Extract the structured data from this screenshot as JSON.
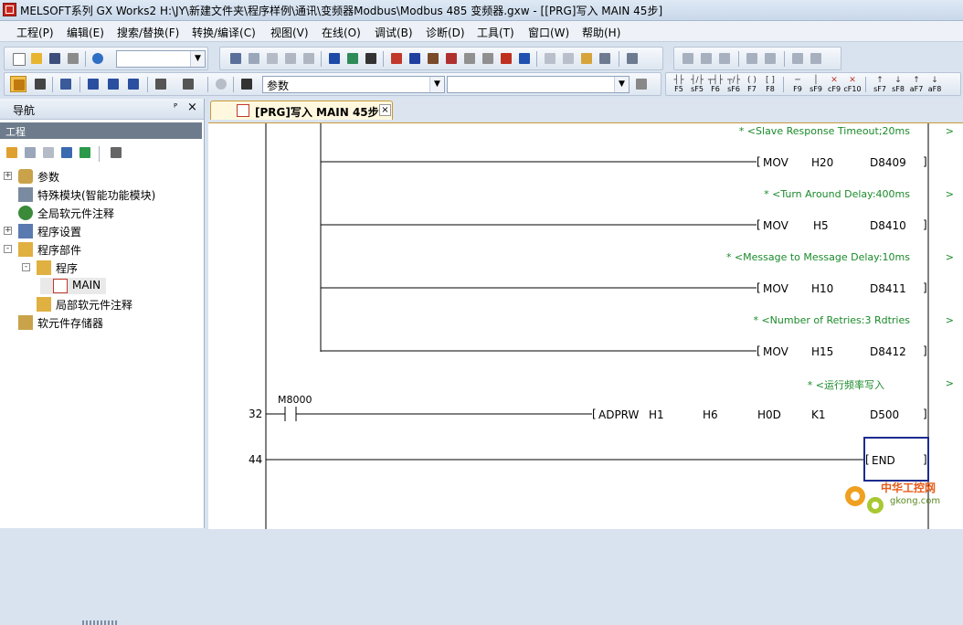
{
  "window": {
    "title": "MELSOFT系列 GX Works2 H:\\JY\\新建文件夹\\程序样例\\通讯\\变频器Modbus\\Modbus 485 变频器.gxw - [[PRG]写入 MAIN 45步]"
  },
  "menu": [
    "工程(P)",
    "编辑(E)",
    "搜索/替换(F)",
    "转换/编译(C)",
    "视图(V)",
    "在线(O)",
    "调试(B)",
    "诊断(D)",
    "工具(T)",
    "窗口(W)",
    "帮助(H)"
  ],
  "toolbar": {
    "combo1_value": "",
    "combo2_value": "参数",
    "combo3_value": "",
    "fkeys": [
      "F5",
      "sF5",
      "F6",
      "sF6",
      "F7",
      "F8",
      "F9",
      "sF9",
      "cF9",
      "cF10",
      "sF7",
      "sF8",
      "aF7",
      "aF8"
    ]
  },
  "nav": {
    "title": "导航",
    "pin": "ᴾ",
    "close": "×",
    "project_header": "工程",
    "tree": [
      {
        "label": "参数",
        "expander": "+"
      },
      {
        "label": "特殊模块(智能功能模块)",
        "expander": ""
      },
      {
        "label": "全局软元件注释",
        "expander": ""
      },
      {
        "label": "程序设置",
        "expander": "+"
      },
      {
        "label": "程序部件",
        "expander": "-"
      },
      {
        "label": "程序",
        "expander": "-"
      },
      {
        "label": "MAIN",
        "expander": ""
      },
      {
        "label": "局部软元件注释",
        "expander": ""
      },
      {
        "label": "软元件存储器",
        "expander": ""
      }
    ]
  },
  "editor": {
    "tab_label": "[PRG]写入 MAIN 45步",
    "tab_close": "×",
    "comments": [
      "* <Slave Response Timeout;20ms",
      "* <Turn Around Delay:400ms",
      "* <Message to Message Delay:10ms",
      "* <Number of Retries:3 Rdtries",
      "* <运行频率写入"
    ],
    "comment_end": ">",
    "rows": [
      {
        "op": "MOV",
        "a": "H20",
        "b": "D8409"
      },
      {
        "op": "MOV",
        "a": "H5",
        "b": "D8410"
      },
      {
        "op": "MOV",
        "a": "H10",
        "b": "D8411"
      },
      {
        "op": "MOV",
        "a": "H15",
        "b": "D8412"
      }
    ],
    "adprw": {
      "op": "ADPRW",
      "args": [
        "H1",
        "H6",
        "H0D",
        "K1",
        "D500"
      ]
    },
    "contact": "M8000",
    "step_32": "32",
    "step_44": "44",
    "end": "END"
  },
  "watermark": {
    "line1": "中华工控网",
    "line2": "gkong.com"
  },
  "colors": {
    "comment": "#1a8a2a",
    "selection": "#1d2b8f",
    "tab_border": "#c79a3c"
  }
}
